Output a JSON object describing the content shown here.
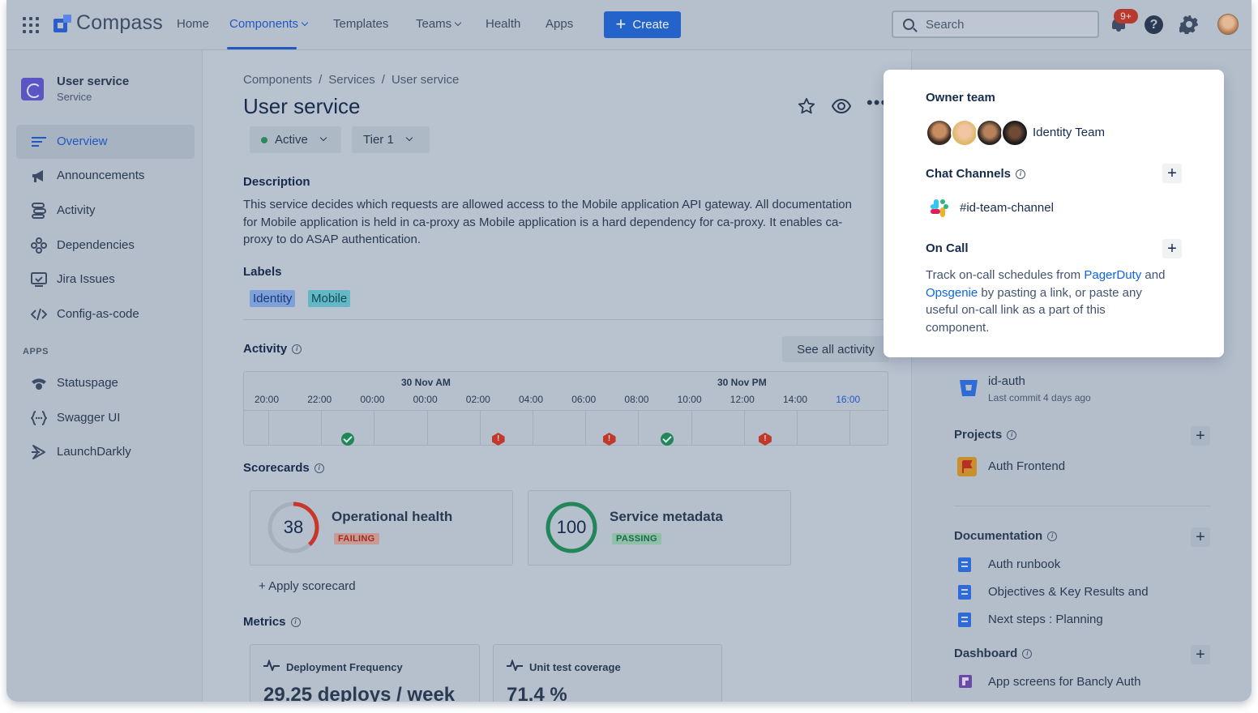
{
  "nav": {
    "logo": "Compass",
    "items": [
      "Home",
      "Components",
      "Templates",
      "Teams",
      "Health",
      "Apps"
    ],
    "create_label": "Create",
    "search_placeholder": "Search",
    "notification_count": "9+"
  },
  "sidebar": {
    "service_name": "User service",
    "service_type": "Service",
    "items": [
      {
        "label": "Overview",
        "icon": "overview-lines-icon",
        "active": true
      },
      {
        "label": "Announcements",
        "icon": "megaphone-icon"
      },
      {
        "label": "Activity",
        "icon": "activity-icon"
      },
      {
        "label": "Dependencies",
        "icon": "dependencies-icon"
      },
      {
        "label": "Jira Issues",
        "icon": "jira-issues-icon"
      },
      {
        "label": "Config-as-code",
        "icon": "code-icon"
      }
    ],
    "apps_heading": "APPS",
    "apps": [
      {
        "label": "Statuspage",
        "icon": "statuspage-icon"
      },
      {
        "label": "Swagger UI",
        "icon": "swagger-icon"
      },
      {
        "label": "LaunchDarkly",
        "icon": "launchdarkly-icon"
      }
    ]
  },
  "main": {
    "breadcrumb": [
      "Components",
      "Services",
      "User service"
    ],
    "title": "User service",
    "status": "Active",
    "tier": "Tier 1",
    "description_heading": "Description",
    "description": "This service decides which requests are allowed access to the Mobile application API gateway. All documentation for Mobile application is held in ca-proxy as Mobile application is a hard dependency for ca-proxy. It enables ca-proxy to do ASAP authentication.",
    "labels_heading": "Labels",
    "labels": [
      "Identity",
      "Mobile"
    ],
    "activity_heading": "Activity",
    "see_all": "See all activity",
    "timeline": {
      "dates": [
        "30 Nov AM",
        "30 Nov PM"
      ],
      "ticks": [
        "20:00",
        "22:00",
        "00:00",
        "00:00",
        "02:00",
        "04:00",
        "06:00",
        "08:00",
        "10:00",
        "12:00",
        "14:00",
        "16:00"
      ],
      "events": [
        {
          "tick_index": 1,
          "kind": "success"
        },
        {
          "tick_index": 3.85,
          "kind": "error"
        },
        {
          "tick_index": 5.95,
          "kind": "error"
        },
        {
          "tick_index": 7.05,
          "kind": "success"
        },
        {
          "tick_index": 8.9,
          "kind": "error"
        }
      ]
    },
    "scorecards_heading": "Scorecards",
    "scorecards": [
      {
        "score": "38",
        "percent": 38,
        "name": "Operational health",
        "status": "FAILING",
        "color": "#c9372c"
      },
      {
        "score": "100",
        "percent": 100,
        "name": "Service metadata",
        "status": "PASSING",
        "color": "#22865a"
      }
    ],
    "apply_scorecard": "+ Apply scorecard",
    "metrics_heading": "Metrics",
    "metrics": [
      {
        "name": "Deployment Frequency",
        "value": "29.25 deploys / week"
      },
      {
        "name": "Unit test coverage",
        "value": "71.4 %"
      }
    ]
  },
  "right": {
    "repo_name": "id-auth",
    "repo_sub": "Last commit 4 days ago",
    "projects_heading": "Projects",
    "project": "Auth Frontend",
    "documentation_heading": "Documentation",
    "docs": [
      "Auth runbook",
      "Objectives & Key Results and",
      "Next steps : Planning"
    ],
    "dashboard_heading": "Dashboard",
    "dashboard": "App screens for Bancly Auth"
  },
  "popover": {
    "owner_heading": "Owner team",
    "team_name": "Identity Team",
    "chat_heading": "Chat Channels",
    "channel": "#id-team-channel",
    "oncall_heading": "On Call",
    "oncall_pre": "Track on-call schedules from ",
    "pagerduty": "PagerDuty",
    "oncall_mid": " and ",
    "opsgenie": "Opsgenie",
    "oncall_post": " by pasting a link, or paste any useful on-call link as a part of this component."
  }
}
